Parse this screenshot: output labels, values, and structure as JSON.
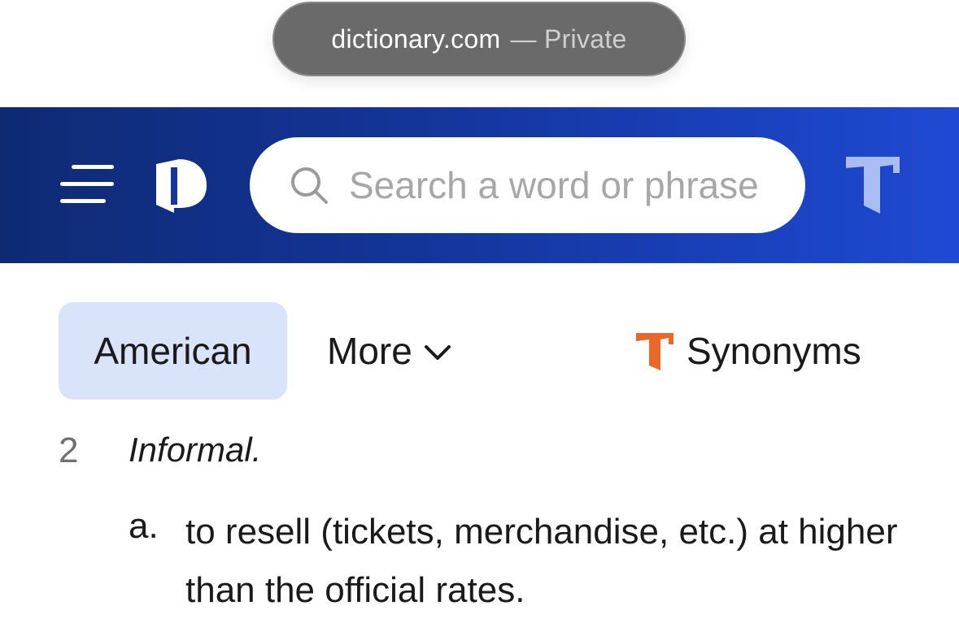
{
  "browser": {
    "domain": "dictionary.com",
    "mode_label": "— Private"
  },
  "header": {
    "menu_icon": "hamburger-menu-icon",
    "logo_icon": "dictionary-logo-icon",
    "search": {
      "placeholder": "Search a word or phrase",
      "value": "",
      "icon": "search-icon"
    },
    "thesaurus_icon": "thesaurus-logo-icon",
    "colors": {
      "gradient_start": "#0f2a73",
      "gradient_end": "#1f49d3"
    }
  },
  "tabs": {
    "american": "American",
    "more": "More",
    "synonyms": "Synonyms",
    "active_tab_bg": "#d9e4fb",
    "synonyms_icon_color": "#e8682a"
  },
  "definition": {
    "number": "2",
    "label": "Informal.",
    "sub": [
      {
        "letter": "a.",
        "text": "to resell (tickets, merchandise, etc.) at higher than the official rates."
      }
    ]
  }
}
